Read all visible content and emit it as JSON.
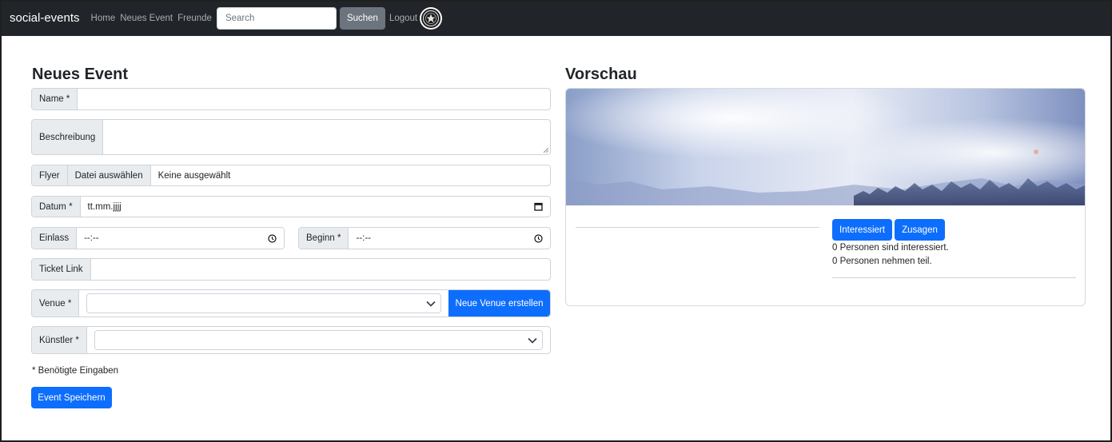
{
  "nav": {
    "brand": "social-events",
    "links": [
      "Home",
      "Neues Event",
      "Freunde"
    ],
    "search_placeholder": "Search",
    "search_button": "Suchen",
    "logout": "Logout"
  },
  "form": {
    "title": "Neues Event",
    "name_label": "Name *",
    "description_label": "Beschreibung",
    "flyer_label": "Flyer",
    "file_button": "Datei auswählen",
    "file_status": "Keine ausgewählt",
    "date_label": "Datum *",
    "date_value": "tt.mm.jjjj",
    "entry_label": "Einlass",
    "entry_value": "--:--",
    "start_label": "Beginn *",
    "start_value": "--:--",
    "ticket_label": "Ticket Link",
    "venue_label": "Venue *",
    "new_venue_button": "Neue Venue erstellen",
    "artist_label": "Künstler *",
    "required_note": "* Benötigte Eingaben",
    "save_button": "Event Speichern"
  },
  "preview": {
    "title": "Vorschau",
    "interested_button": "Interessiert",
    "attend_button": "Zusagen",
    "interested_text": "0 Personen sind interessiert.",
    "attending_text": "0 Personen nehmen teil."
  },
  "colors": {
    "navbar": "#212529",
    "primary": "#0d6efd",
    "secondary": "#6c757d"
  }
}
